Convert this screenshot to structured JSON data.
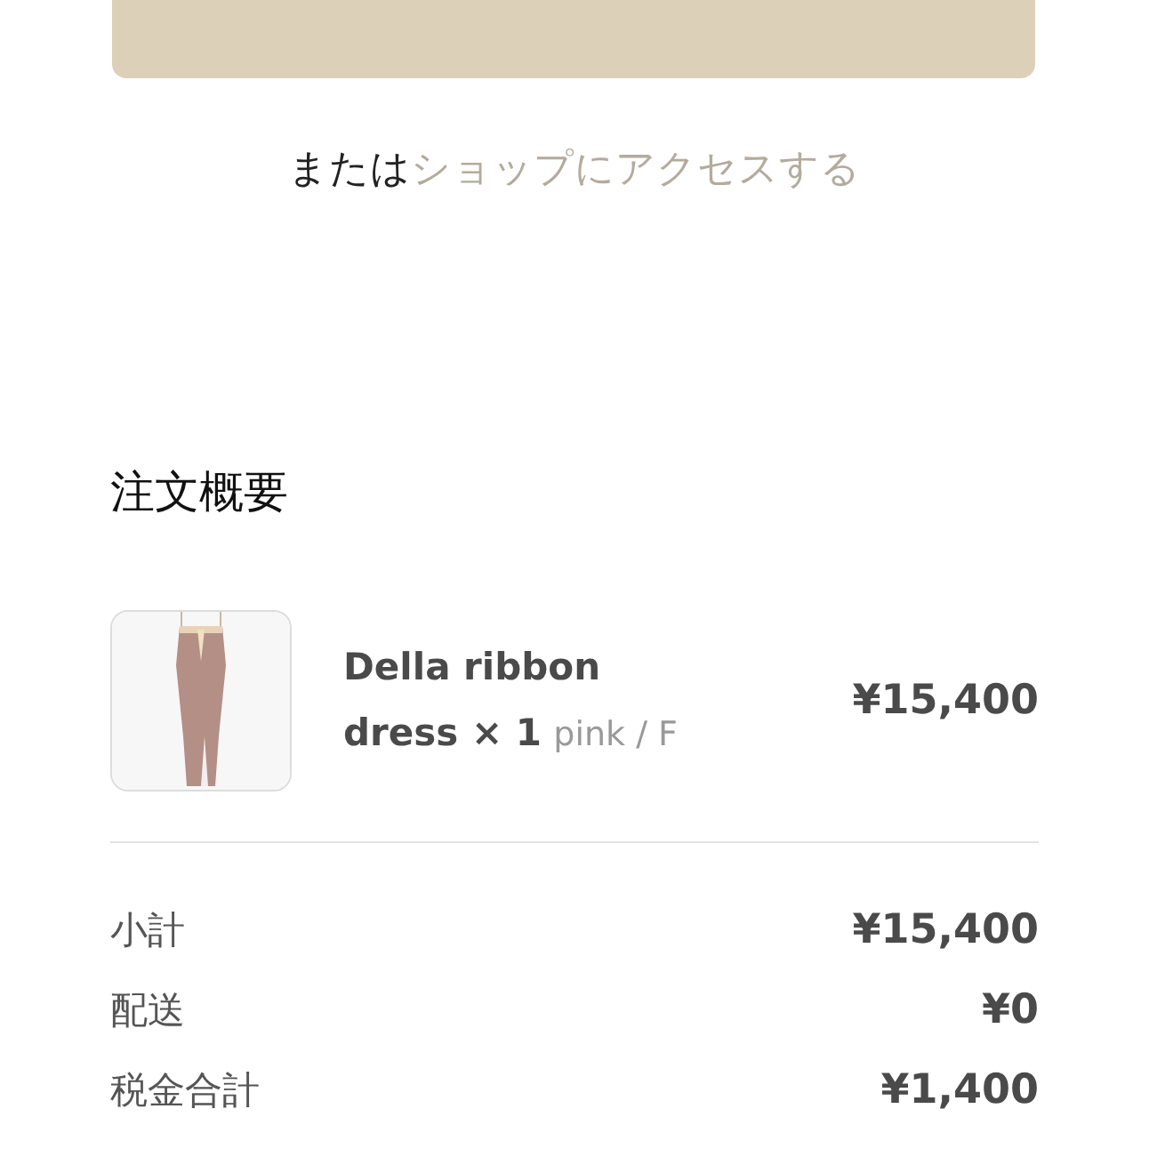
{
  "view_order_button": {
    "kind": "button"
  },
  "alternative": {
    "prefix": "または",
    "link": "ショップにアクセスする"
  },
  "order_summary": {
    "title": "注文概要",
    "items": [
      {
        "kind": "picture",
        "name": "Della ribbon dress × 1",
        "variant": "pink / F",
        "price": "¥15,400"
      }
    ]
  },
  "totals": [
    {
      "label": "小計",
      "value": "¥15,400"
    },
    {
      "label": "配送",
      "value": "¥0"
    },
    {
      "label": "税金合計",
      "value": "¥1,400"
    }
  ]
}
